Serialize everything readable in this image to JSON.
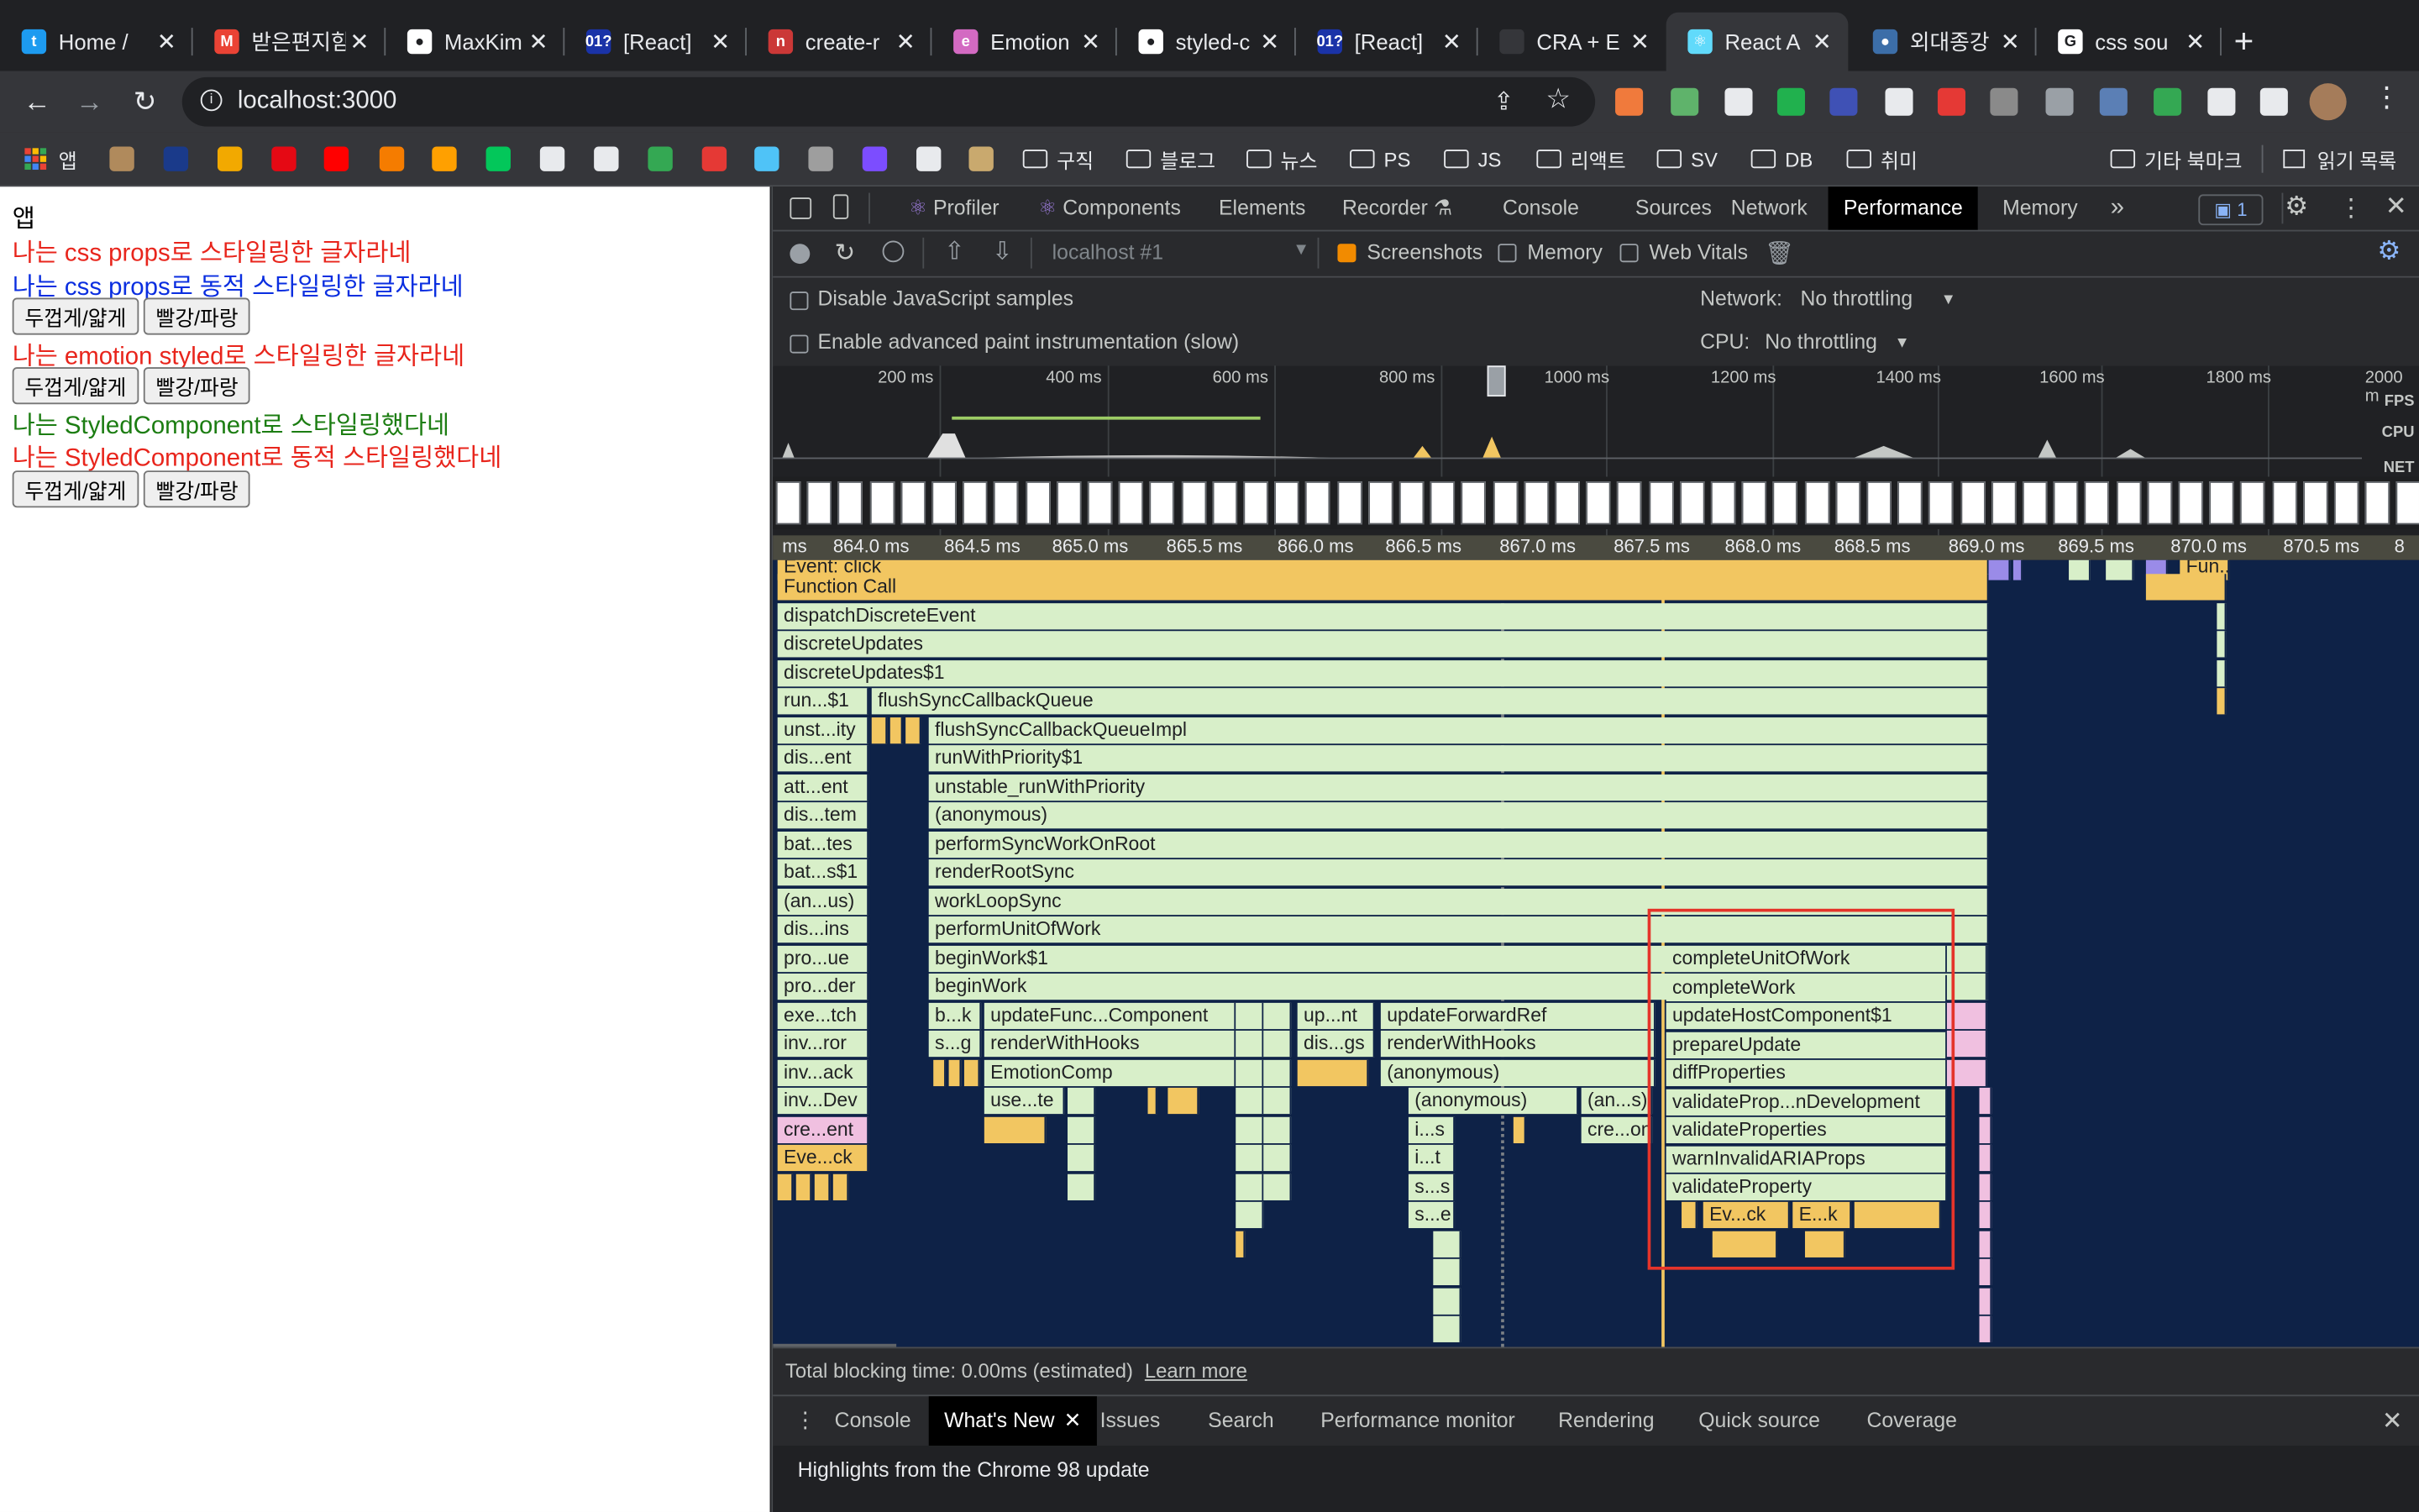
{
  "browser": {
    "tabs": [
      {
        "title": "Home /",
        "icon": "twitter-icon",
        "color": "#1d9bf0",
        "glyph": "t"
      },
      {
        "title": "받은편지함",
        "icon": "gmail-icon",
        "color": "#ea4335",
        "glyph": "M"
      },
      {
        "title": "MaxKim",
        "icon": "github-icon",
        "color": "#ffffff",
        "glyph": "●"
      },
      {
        "title": "[React]",
        "icon": "velog-icon",
        "color": "#1a33a8",
        "glyph": "01?"
      },
      {
        "title": "create-r",
        "icon": "npm-icon",
        "color": "#cb3837",
        "glyph": "n"
      },
      {
        "title": "Emotion",
        "icon": "emotion-icon",
        "color": "#d36ac2",
        "glyph": "e"
      },
      {
        "title": "styled-c",
        "icon": "github-icon",
        "color": "#ffffff",
        "glyph": "●"
      },
      {
        "title": "[React]",
        "icon": "velog-icon",
        "color": "#1a33a8",
        "glyph": "01?"
      },
      {
        "title": "CRA + E",
        "icon": "blank-icon",
        "color": "#35363a",
        "glyph": ""
      },
      {
        "title": "React A",
        "icon": "react-icon",
        "color": "#61dafb",
        "glyph": "⚛"
      },
      {
        "title": "외대종강",
        "icon": "site-icon",
        "color": "#3c6ea8",
        "glyph": "●"
      },
      {
        "title": "css sou",
        "icon": "google-icon",
        "color": "#ffffff",
        "glyph": "G"
      }
    ],
    "new_tab": "+",
    "url": "localhost:3000",
    "bookmarks": {
      "apps_label": "앱",
      "folders": [
        "구직",
        "블로그",
        "뉴스",
        "PS",
        "JS",
        "리액트",
        "SV",
        "DB",
        "취미"
      ],
      "other": "기타 북마크",
      "reading": "읽기 목록"
    }
  },
  "app": {
    "title": "앱",
    "line1": "나는 css props로 스타일링한 글자라네",
    "line2": "나는 css props로 동적 스타일링한 글자라네",
    "line3": "나는 emotion styled로 스타일링한 글자라네",
    "line4": "나는 StyledComponent로 스타일링했다네",
    "line5": "나는 StyledComponent로 동적 스타일링했다네",
    "btn_bold": "두껍게/얇게",
    "btn_color": "빨강/파랑",
    "colors": {
      "red": "#e8251c",
      "blue": "#0a2ee0",
      "green": "#1c7d12"
    }
  },
  "devtools": {
    "tabs": [
      "Profiler",
      "Components",
      "Elements",
      "Recorder",
      "Console",
      "Sources",
      "Network",
      "Performance",
      "Memory"
    ],
    "active_tab": "Performance",
    "issues_count": "1",
    "recording_select": "localhost #1",
    "screenshots": "Screenshots",
    "memory": "Memory",
    "web_vitals": "Web Vitals",
    "disable_js": "Disable JavaScript samples",
    "advanced_paint": "Enable advanced paint instrumentation (slow)",
    "network_label": "Network:",
    "network_value": "No throttling",
    "cpu_label": "CPU:",
    "cpu_value": "No throttling",
    "overview_ticks": [
      "200 ms",
      "400 ms",
      "600 ms",
      "800 ms",
      "1000 ms",
      "1200 ms",
      "1400 ms",
      "1600 ms",
      "1800 ms",
      "2000 m"
    ],
    "lane_labels": [
      "FPS",
      "CPU",
      "NET"
    ],
    "ruler_ticks": [
      "ms",
      "864.0 ms",
      "864.5 ms",
      "865.0 ms",
      "865.5 ms",
      "866.0 ms",
      "866.5 ms",
      "867.0 ms",
      "867.5 ms",
      "868.0 ms",
      "868.5 ms",
      "869.0 ms",
      "869.5 ms",
      "870.0 ms",
      "870.5 ms",
      "8"
    ],
    "flame_texts": {
      "event": "Event: click",
      "function_call": "Function Call",
      "fun_ll": "Fun...ll",
      "dispatch": "dispatchDiscreteEvent",
      "discrete": "discreteUpdates",
      "discrete1": "discreteUpdates$1",
      "left": [
        "run...$1",
        "unst...ity",
        "dis...ent",
        "att...ent",
        "dis...tem",
        "bat...tes",
        "bat...s$1",
        "(an...us)",
        "dis...ins",
        "pro...ue",
        "pro...der",
        "exe...tch",
        "inv...ror",
        "inv...ack",
        "inv...Dev",
        "cre...ent",
        "Eve...ck"
      ],
      "mid": [
        "flushSyncCallbackQueue",
        "flushSyncCallbackQueueImpl",
        "runWithPriority$1",
        "unstable_runWithPriority",
        "(anonymous)",
        "performSyncWorkOnRoot",
        "renderRootSync",
        "workLoopSync",
        "performUnitOfWork",
        "beginWork$1",
        "beginWork"
      ],
      "bk": "b...k",
      "sg": "s...g",
      "update_func": "updateFunc...Component",
      "render_hooks": "renderWithHooks",
      "emotion_comp": "EmotionComp",
      "use_te": "use...te",
      "up_nt": "up...nt",
      "dis_gs": "dis...gs",
      "update_fwd": "updateForwardRef",
      "render_hooks2": "renderWithHooks",
      "anonymous": "(anonymous)",
      "anonymous2": "(anonymous)",
      "an_s": "(an...s)",
      "cre_on": "cre...on",
      "is": "i...s",
      "it": "i...t",
      "ss": "s...s",
      "se": "s...e",
      "right": [
        "completeUnitOfWork",
        "completeWork",
        "updateHostComponent$1",
        "prepareUpdate",
        "diffProperties",
        "validateProp...nDevelopment",
        "validateProperties",
        "warnInvalidARIAProps",
        "validateProperty"
      ],
      "ev_ck": "Ev...ck",
      "ek": "E...k"
    },
    "total_blocking": "Total blocking time: 0.00ms (estimated)",
    "learn_more": "Learn more",
    "drawer_tabs": [
      "Console",
      "What's New",
      "Issues",
      "Search",
      "Performance monitor",
      "Rendering",
      "Quick source",
      "Coverage"
    ],
    "drawer_active": "What's New",
    "whats_new": "Highlights from the Chrome 98 update"
  }
}
